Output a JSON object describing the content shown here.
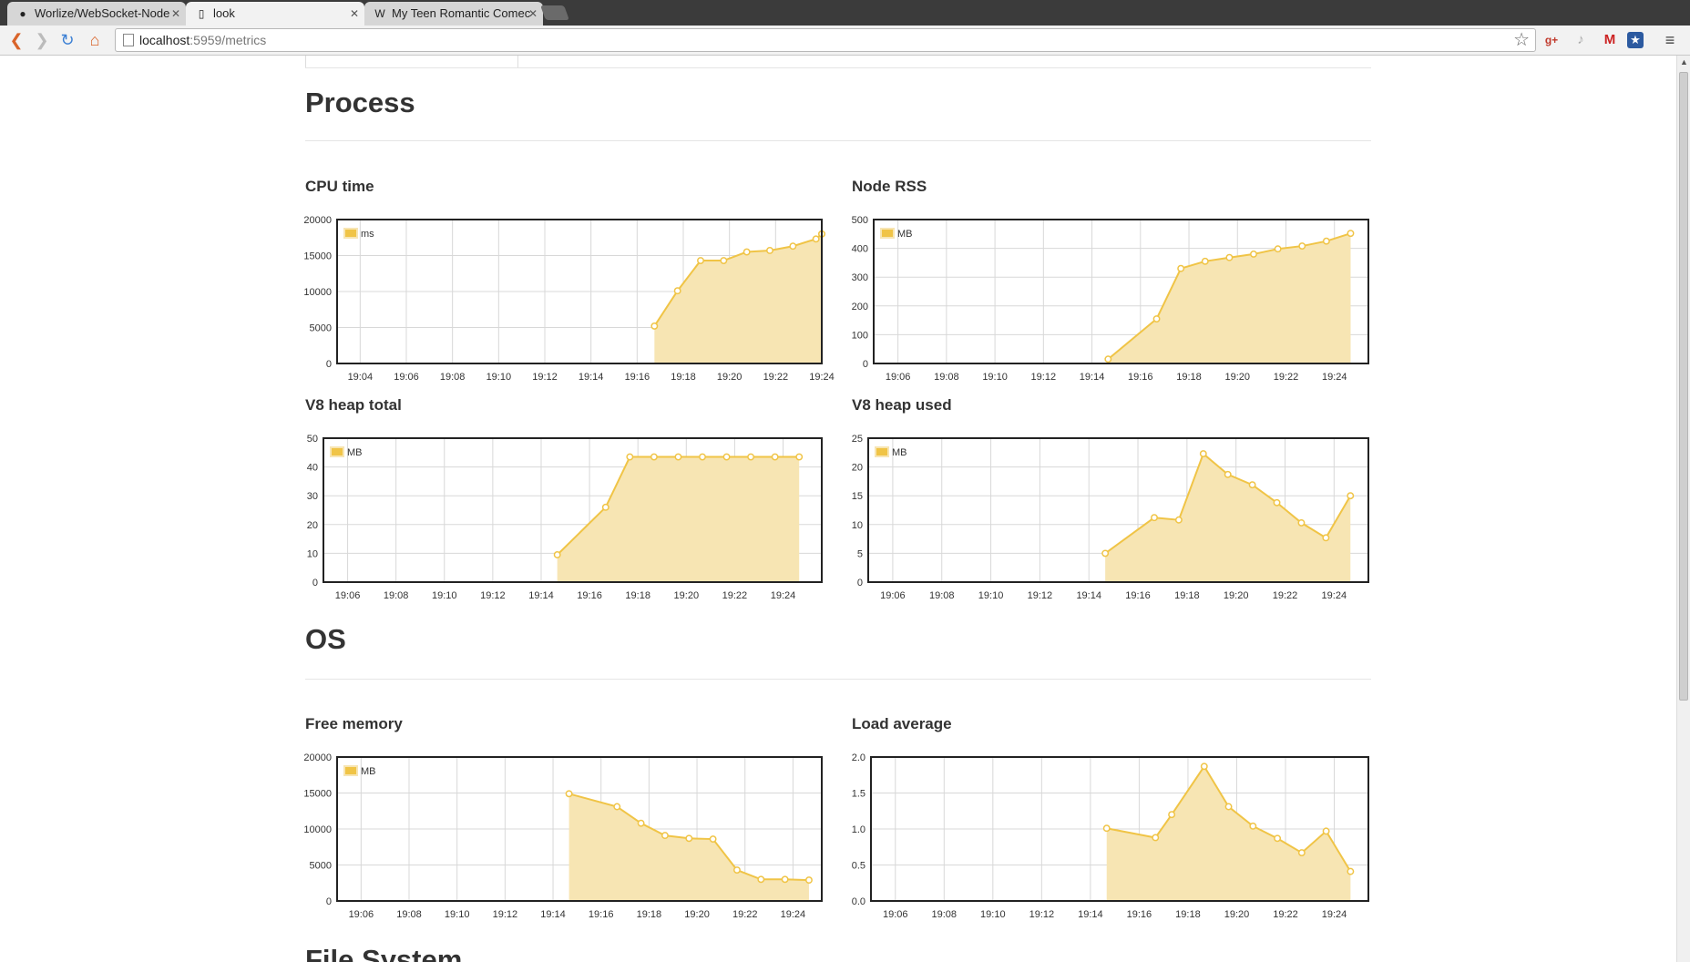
{
  "browser": {
    "tabs": [
      {
        "title": "Worlize/WebSocket-Node",
        "icon": "github-icon",
        "active": false
      },
      {
        "title": "look",
        "icon": "page-icon",
        "active": true
      },
      {
        "title": "My Teen Romantic Comec",
        "icon": "wikipedia-icon",
        "active": false
      }
    ],
    "url_host": "localhost",
    "url_path": ":5959/metrics"
  },
  "sections": {
    "process": "Process",
    "os": "OS",
    "filesystem": "File System"
  },
  "colors": {
    "line": "#f0c446",
    "fill": "#f7e5b3",
    "grid": "#d8d8d8",
    "frame": "#222222"
  },
  "chart_data": [
    {
      "title": "CPU time",
      "type": "area",
      "legend": "ms",
      "legend_position": "top-left",
      "ylim": [
        0,
        20000
      ],
      "yticks": [
        "20000",
        "15000",
        "10000",
        "5000",
        "0"
      ],
      "xlim": [
        0,
        21
      ],
      "xticks": [
        "19:04",
        "19:06",
        "19:08",
        "19:10",
        "19:12",
        "19:14",
        "19:16",
        "19:18",
        "19:20",
        "19:22",
        "19:24"
      ],
      "x": [
        "19:16:45",
        "19:17:45",
        "19:18:45",
        "19:19:45",
        "19:20:45",
        "19:21:45",
        "19:22:45",
        "19:23:45",
        "19:24:45",
        "19:25:45"
      ],
      "values": [
        5200,
        10100,
        14300,
        14300,
        15500,
        15700,
        16300,
        17300,
        18000,
        18000
      ]
    },
    {
      "title": "Node RSS",
      "type": "area",
      "legend": "MB",
      "legend_position": "top-left",
      "ylim": [
        0,
        500
      ],
      "yticks": [
        "500",
        "400",
        "300",
        "200",
        "100",
        "0"
      ],
      "xlim": [
        0,
        20.4
      ],
      "xticks": [
        "19:06",
        "19:08",
        "19:10",
        "19:12",
        "19:14",
        "19:16",
        "19:18",
        "19:20",
        "19:22",
        "19:24"
      ],
      "x": [
        "19:14:40",
        "19:16:40",
        "19:17:40",
        "19:18:40",
        "19:19:40",
        "19:20:40",
        "19:21:40",
        "19:22:40",
        "19:23:40",
        "19:24:40"
      ],
      "values": [
        15,
        155,
        330,
        355,
        368,
        380,
        398,
        408,
        425,
        452
      ]
    },
    {
      "title": "V8 heap total",
      "type": "area",
      "legend": "MB",
      "legend_position": "top-left",
      "ylim": [
        0,
        50
      ],
      "yticks": [
        "50",
        "40",
        "30",
        "20",
        "10",
        "0"
      ],
      "xlim": [
        0,
        20.6
      ],
      "xticks": [
        "19:06",
        "19:08",
        "19:10",
        "19:12",
        "19:14",
        "19:16",
        "19:18",
        "19:20",
        "19:22",
        "19:24"
      ],
      "x": [
        "19:14:40",
        "19:16:40",
        "19:17:40",
        "19:18:40",
        "19:19:40",
        "19:20:40",
        "19:21:40",
        "19:22:40",
        "19:23:40",
        "19:24:40"
      ],
      "values": [
        9.5,
        26,
        43.5,
        43.5,
        43.5,
        43.5,
        43.5,
        43.5,
        43.5,
        43.5
      ]
    },
    {
      "title": "V8 heap used",
      "type": "area",
      "legend": "MB",
      "legend_position": "top-left",
      "ylim": [
        0,
        25
      ],
      "yticks": [
        "25",
        "20",
        "15",
        "10",
        "5",
        "0"
      ],
      "xlim": [
        0,
        20.4
      ],
      "xticks": [
        "19:06",
        "19:08",
        "19:10",
        "19:12",
        "19:14",
        "19:16",
        "19:18",
        "19:20",
        "19:22",
        "19:24"
      ],
      "x": [
        "19:14:40",
        "19:16:40",
        "19:17:40",
        "19:18:40",
        "19:19:40",
        "19:20:40",
        "19:21:40",
        "19:22:40",
        "19:23:40",
        "19:24:40"
      ],
      "values": [
        5,
        11.2,
        10.8,
        22.3,
        18.7,
        16.9,
        13.8,
        10.3,
        7.7,
        15
      ]
    },
    {
      "title": "Free memory",
      "type": "area",
      "legend": "MB",
      "legend_position": "top-left",
      "ylim": [
        0,
        20000
      ],
      "yticks": [
        "20000",
        "15000",
        "10000",
        "5000",
        "0"
      ],
      "xlim": [
        0,
        20.2
      ],
      "xticks": [
        "19:06",
        "19:08",
        "19:10",
        "19:12",
        "19:14",
        "19:16",
        "19:18",
        "19:20",
        "19:22",
        "19:24"
      ],
      "x": [
        "19:14:40",
        "19:16:40",
        "19:17:40",
        "19:18:40",
        "19:19:40",
        "19:20:40",
        "19:21:40",
        "19:22:40",
        "19:23:40",
        "19:24:40"
      ],
      "values": [
        14900,
        13100,
        10800,
        9100,
        8700,
        8600,
        4300,
        3000,
        3000,
        2900
      ]
    },
    {
      "title": "Load average",
      "type": "area",
      "legend": "",
      "legend_position": "",
      "ylim": [
        0,
        2
      ],
      "yticks": [
        "2.0",
        "1.5",
        "1.0",
        "0.5",
        "0.0"
      ],
      "xlim": [
        0,
        20.4
      ],
      "xticks": [
        "19:06",
        "19:08",
        "19:10",
        "19:12",
        "19:14",
        "19:16",
        "19:18",
        "19:20",
        "19:22",
        "19:24"
      ],
      "x": [
        "19:14:40",
        "19:16:40",
        "19:17:20",
        "19:18:40",
        "19:19:40",
        "19:20:40",
        "19:21:40",
        "19:22:40",
        "19:23:40",
        "19:24:40"
      ],
      "values": [
        1.01,
        0.88,
        1.2,
        1.87,
        1.31,
        1.04,
        0.87,
        0.67,
        0.97,
        0.41
      ]
    }
  ]
}
